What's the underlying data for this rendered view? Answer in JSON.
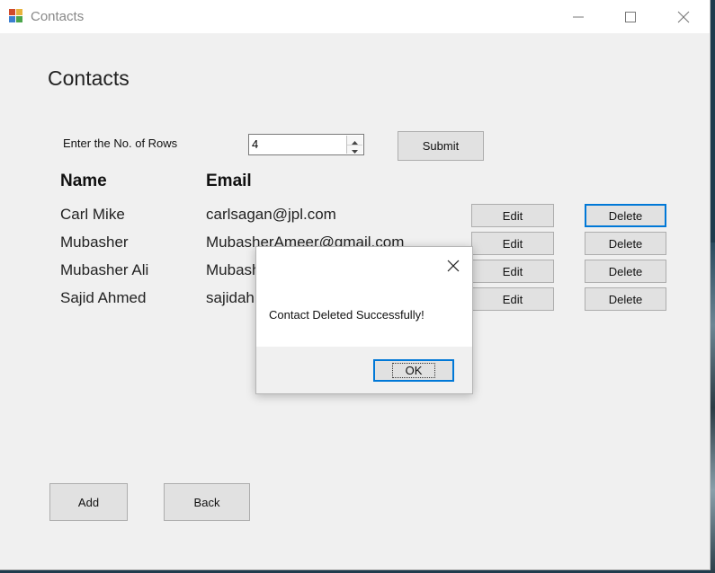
{
  "window": {
    "title": "Contacts"
  },
  "page": {
    "heading": "Contacts"
  },
  "rows_input": {
    "label": "Enter the No. of Rows",
    "value": "4"
  },
  "submit_label": "Submit",
  "table": {
    "headers": [
      "Name",
      "Email"
    ],
    "rows": [
      {
        "name": "Carl Mike",
        "email": "carlsagan@jpl.com",
        "edit": "Edit",
        "delete": "Delete"
      },
      {
        "name": "Mubasher",
        "email": "MubasherAmeer@gmail.com",
        "edit": "Edit",
        "delete": "Delete"
      },
      {
        "name": "Mubasher Ali",
        "email": "Mubash",
        "edit": "Edit",
        "delete": "Delete"
      },
      {
        "name": "Sajid Ahmed",
        "email": "sajidahr",
        "edit": "Edit",
        "delete": "Delete"
      }
    ]
  },
  "footer": {
    "add_label": "Add",
    "back_label": "Back"
  },
  "dialog": {
    "message": "Contact Deleted Successfully!",
    "ok_label": "OK"
  },
  "colors": {
    "accent": "#0078d7",
    "window_bg": "#f0f0f0"
  },
  "icons": [
    "app-icon",
    "minimize-icon",
    "maximize-icon",
    "close-icon",
    "spin-up-icon",
    "spin-down-icon",
    "dialog-close-icon"
  ]
}
